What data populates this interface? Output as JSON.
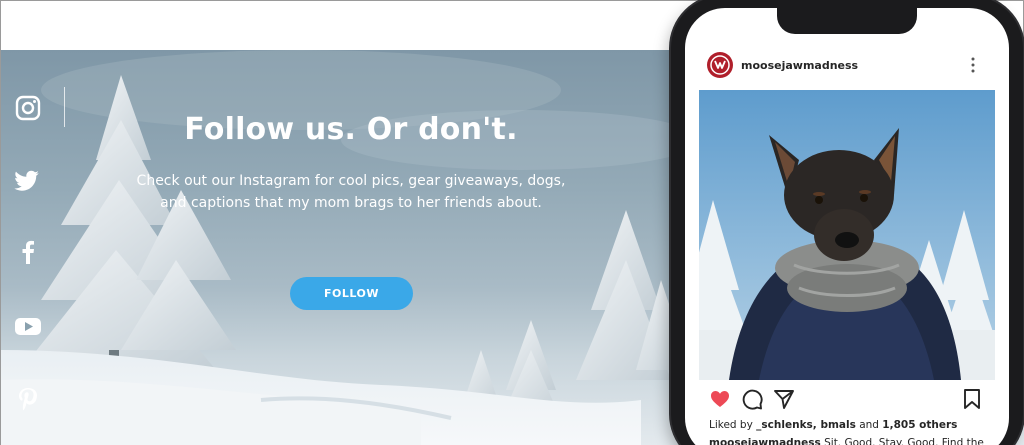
{
  "colors": {
    "follow_button": "#3aa8e8",
    "heart": "#ed4956",
    "avatar": "#b01f2b",
    "sky": "#94aab7"
  },
  "hero": {
    "headline": "Follow us. Or don't.",
    "subtext": "Check out our Instagram for cool pics, gear giveaways, dogs, and captions that my mom brags to her friends about.",
    "follow_button_label": "FOLLOW"
  },
  "social_icons": [
    "instagram-icon",
    "twitter-icon",
    "facebook-icon",
    "youtube-icon",
    "pinterest-icon"
  ],
  "instagram_post": {
    "username": "moosejawmadness",
    "likes_prefix": "Liked by",
    "liked_users": "_schlenks, bmals",
    "likes_and": "and",
    "likes_count": "1,805 others",
    "caption_user": "moosejawmadness",
    "caption_text": "Sit. Good. Stay. Good. Find the"
  }
}
